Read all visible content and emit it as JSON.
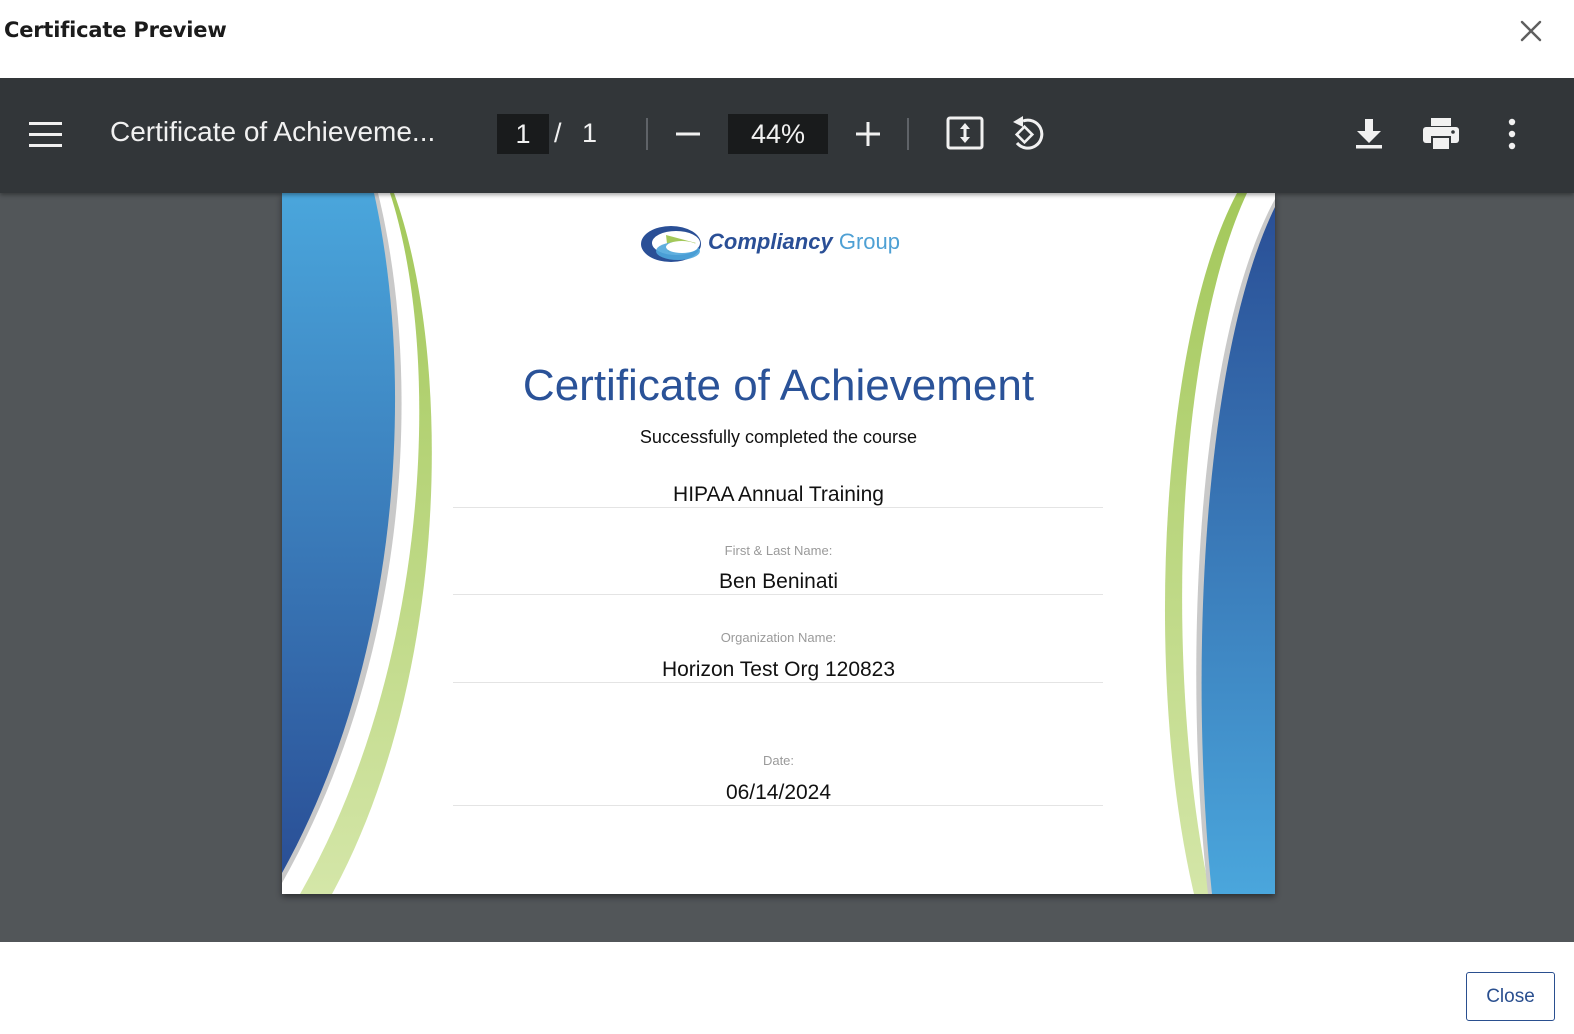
{
  "modal": {
    "title": "Certificate Preview",
    "close_icon": "close-icon"
  },
  "viewer": {
    "toolbar": {
      "menu_icon": "hamburger-menu-icon",
      "document_title": "Certificate of Achieveme...",
      "current_page": "1",
      "page_separator": "/",
      "total_pages": "1",
      "zoom_out_icon": "minus-icon",
      "zoom_level": "44%",
      "zoom_in_icon": "plus-icon",
      "fit_page_icon": "fit-to-page-icon",
      "rotate_icon": "rotate-counterclockwise-icon",
      "download_icon": "download-icon",
      "print_icon": "print-icon",
      "more_icon": "more-vertical-icon"
    },
    "certificate": {
      "logo_brand": "Compliancy",
      "logo_suffix": "Group",
      "title": "Certificate of Achievement",
      "subtitle": "Successfully completed the course",
      "course_name": "HIPAA Annual Training",
      "name_label": "First & Last Name:",
      "name_value": "Ben Beninati",
      "org_label": "Organization Name:",
      "org_value": "Horizon Test Org 120823",
      "date_label": "Date:",
      "date_value": "06/14/2024",
      "colors": {
        "primary_blue": "#2a5298",
        "light_blue": "#4ea6dc",
        "green": "#a3c85a",
        "light_green": "#cfe2a2"
      }
    }
  },
  "footer": {
    "close_label": "Close"
  },
  "colors": {
    "toolbar_bg": "#323639",
    "viewer_bg": "#525659",
    "accent": "#2a4f8f"
  }
}
